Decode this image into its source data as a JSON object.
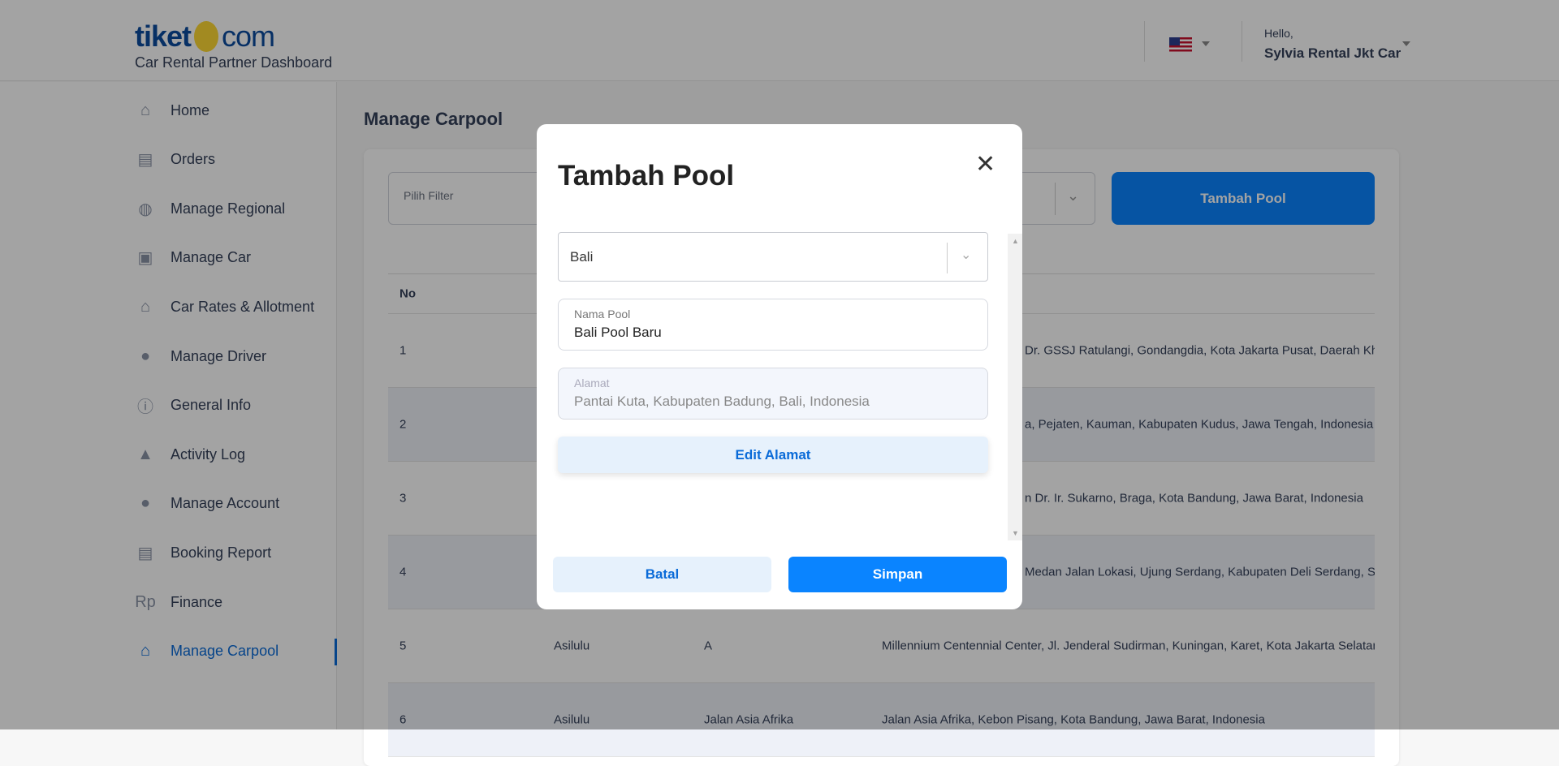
{
  "header": {
    "logo": {
      "left": "tiket",
      "right": "com"
    },
    "subtitle": "Car Rental Partner Dashboard",
    "language_icon": "us-flag-icon",
    "greeting": "Hello,",
    "user_name": "Sylvia Rental Jkt Car"
  },
  "sidebar": {
    "active_color": "#0a6bd8",
    "items": [
      {
        "label": "Home",
        "icon": "home-icon",
        "glyph": "⌂"
      },
      {
        "label": "Orders",
        "icon": "orders-icon",
        "glyph": "▤"
      },
      {
        "label": "Manage Regional",
        "icon": "globe-icon",
        "glyph": "◍"
      },
      {
        "label": "Manage Car",
        "icon": "car-icon",
        "glyph": "▣"
      },
      {
        "label": "Car Rates & Allotment",
        "icon": "garage-icon",
        "glyph": "⌂"
      },
      {
        "label": "Manage Driver",
        "icon": "driver-icon",
        "glyph": "●"
      },
      {
        "label": "General Info",
        "icon": "info-icon",
        "glyph": "ⓘ"
      },
      {
        "label": "Activity Log",
        "icon": "tent-icon",
        "glyph": "▲"
      },
      {
        "label": "Manage Account",
        "icon": "users-icon",
        "glyph": "●"
      },
      {
        "label": "Booking Report",
        "icon": "report-icon",
        "glyph": "▤"
      },
      {
        "label": "Finance",
        "icon": "rupiah-icon",
        "glyph": "Rp"
      },
      {
        "label": "Manage Carpool",
        "icon": "carpool-icon",
        "glyph": "⌂",
        "active": true
      }
    ]
  },
  "main": {
    "title": "Manage Carpool",
    "filter_placeholder": "Pilih Filter",
    "add_button": "Tambah Pool",
    "table": {
      "headers": [
        "No"
      ],
      "rows": [
        {
          "no": "1",
          "address_visible": "Dr. GSSJ Ratulangi, Gondangdia, Kota Jakarta Pusat, Daerah Khu"
        },
        {
          "no": "2",
          "address_visible": "a, Pejaten, Kauman, Kabupaten Kudus, Jawa Tengah, Indonesia"
        },
        {
          "no": "3",
          "address_visible": "n Dr. Ir. Sukarno, Braga, Kota Bandung, Jawa Barat, Indonesia"
        },
        {
          "no": "4",
          "address_visible": "Medan Jalan Lokasi, Ujung Serdang, Kabupaten Deli Serdang, S"
        },
        {
          "no": "5",
          "name": "Asilulu",
          "pool": "A",
          "address": "Millennium Centennial Center, Jl. Jenderal Sudirman, Kuningan, Karet, Kota Jakarta Selatan"
        },
        {
          "no": "6",
          "name": "Asilulu",
          "pool": "Jalan Asia Afrika",
          "address": "Jalan Asia Afrika, Kebon Pisang, Kota Bandung, Jawa Barat, Indonesia"
        }
      ]
    }
  },
  "modal": {
    "title": "Tambah Pool",
    "region_value": "Bali",
    "name_label": "Nama Pool",
    "name_value": "Bali Pool Baru",
    "address_label": "Alamat",
    "address_value": "Pantai Kuta, Kabupaten Badung, Bali, Indonesia",
    "edit_address": "Edit Alamat",
    "cancel": "Batal",
    "save": "Simpan"
  }
}
